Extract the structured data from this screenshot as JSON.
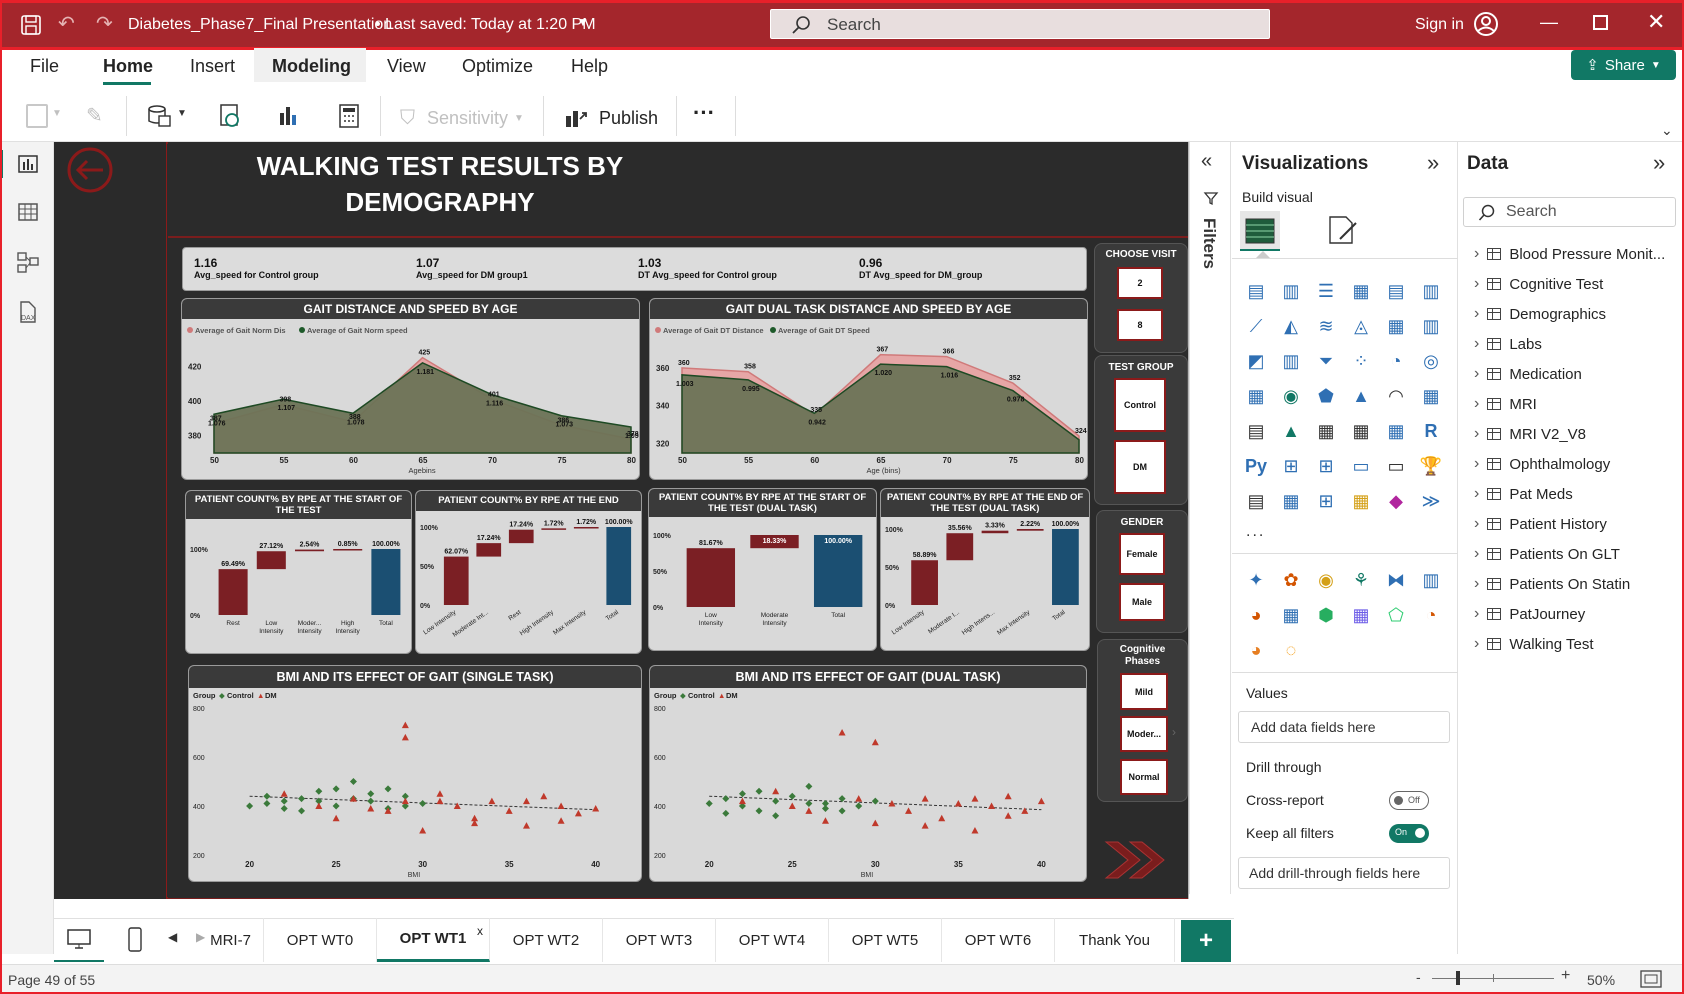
{
  "titlebar": {
    "doc_title": "Diabetes_Phase7_Final Presentation",
    "save_status": "• Last saved: Today at 1:20 PM",
    "search_placeholder": "Search",
    "sign_in": "Sign in"
  },
  "menu": {
    "file": "File",
    "home": "Home",
    "insert": "Insert",
    "modeling": "Modeling",
    "view": "View",
    "optimize": "Optimize",
    "help": "Help",
    "share": "Share"
  },
  "toolbar": {
    "sensitivity": "Sensitivity",
    "publish": "Publish",
    "more": "···"
  },
  "report": {
    "title_line1": "WALKING TEST RESULTS BY",
    "title_line2": "DEMOGRAPHY",
    "cards": [
      {
        "value": "1.16",
        "label": "Avg_speed for Control group"
      },
      {
        "value": "1.07",
        "label": "Avg_speed for DM group1"
      },
      {
        "value": "1.03",
        "label": "DT Avg_speed for Control group"
      },
      {
        "value": "0.96",
        "label": "DT Avg_speed for DM_group"
      }
    ],
    "gait_title": "GAIT DISTANCE AND SPEED BY AGE",
    "gait_legend_1": "Average of Gait Norm Dis",
    "gait_legend_2": "Average of Gait Norm speed",
    "gait_xlabel": "Agebins",
    "dual_title": "GAIT DUAL TASK DISTANCE AND SPEED BY AGE",
    "dual_legend_1": "Average of Gait DT Distance",
    "dual_legend_2": "Average of Gait DT Speed",
    "dual_xlabel": "Age (bins)",
    "rpe_start_title": "PATIENT COUNT% BY RPE AT THE START OF THE TEST",
    "rpe_end_title": "PATIENT COUNT% BY RPE AT THE END",
    "rpe_start_dt_title": "PATIENT COUNT% BY RPE AT THE START OF THE TEST (DUAL TASK)",
    "rpe_end_dt_title": "PATIENT COUNT% BY RPE AT THE END OF THE TEST (DUAL TASK)",
    "bmi_single_title": "BMI AND ITS EFFECT OF GAIT (SINGLE TASK)",
    "bmi_dual_title": "BMI AND ITS EFFECT OF GAIT (DUAL TASK)",
    "bmi_legend_group": "Group",
    "bmi_legend_control": "Control",
    "bmi_legend_dm": "DM",
    "bmi_xlabel": "BMI",
    "slicers": {
      "visit_label": "CHOOSE VISIT",
      "visit_options": [
        "2",
        "8"
      ],
      "group_label": "TEST GROUP",
      "group_options": [
        "Control",
        "DM"
      ],
      "gender_label": "GENDER",
      "gender_options": [
        "Female",
        "Male"
      ],
      "cog_label": "Cognitive Phases",
      "cog_options": [
        "Mild",
        "Moder...",
        "Normal"
      ]
    }
  },
  "chart_data": [
    {
      "type": "area",
      "title": "GAIT DISTANCE AND SPEED BY AGE",
      "xlabel": "Agebins",
      "x": [
        50,
        55,
        60,
        65,
        70,
        75,
        80
      ],
      "ylim": [
        370,
        430
      ],
      "yticks": [
        380,
        400,
        420
      ],
      "series": [
        {
          "name": "Average of Gait Norm Dis",
          "values": [
            387,
            398,
            388,
            425,
            401,
            386,
            378
          ],
          "color": "#d07a7a"
        },
        {
          "name": "Average of Gait Norm speed",
          "values": [
            1.076,
            1.107,
            1.078,
            1.181,
            1.116,
            1.073,
            1.05
          ],
          "color": "#1e5a2a"
        }
      ]
    },
    {
      "type": "area",
      "title": "GAIT DUAL TASK DISTANCE AND SPEED BY AGE",
      "xlabel": "Age (bins)",
      "x": [
        50,
        55,
        60,
        65,
        70,
        75,
        80
      ],
      "ylim": [
        315,
        370
      ],
      "yticks": [
        320,
        340,
        360
      ],
      "series": [
        {
          "name": "Average of Gait DT Distance",
          "values": [
            360,
            358,
            335,
            367,
            366,
            352,
            324
          ],
          "color": "#d07a7a"
        },
        {
          "name": "Average of Gait DT Speed",
          "values": [
            1.003,
            0.995,
            0.942,
            1.02,
            1.016,
            0.978,
            0.9
          ],
          "color": "#1e5a2a"
        }
      ]
    },
    {
      "type": "bar",
      "title": "PATIENT COUNT% BY RPE AT THE START OF THE TEST",
      "categories": [
        "Rest",
        "Low Intensity",
        "Moder... Intensity",
        "High Intensity",
        "Total"
      ],
      "labels": [
        "69.49%",
        "27.12%",
        "2.54%",
        "0.85%",
        "100.00%"
      ],
      "values": [
        69.49,
        27.12,
        2.54,
        0.85,
        100.0
      ],
      "yticks": [
        "0%",
        "100%"
      ]
    },
    {
      "type": "bar",
      "title": "PATIENT COUNT% BY RPE AT THE END",
      "categories": [
        "Low Intensity",
        "Moderate Int...",
        "Rest",
        "High Intensity",
        "Max Intensity",
        "Total"
      ],
      "labels": [
        "62.07%",
        "17.24%",
        "17.24%",
        "1.72%",
        "1.72%",
        "100.00%"
      ],
      "values": [
        62.07,
        17.24,
        17.24,
        1.72,
        1.72,
        100.0
      ],
      "yticks": [
        "0%",
        "50%",
        "100%"
      ]
    },
    {
      "type": "bar",
      "title": "PATIENT COUNT% BY RPE AT THE START OF THE TEST (DUAL TASK)",
      "categories": [
        "Low Intensity",
        "Moderate Intensity",
        "Total"
      ],
      "labels": [
        "81.67%",
        "18.33%",
        "100.00%"
      ],
      "values": [
        81.67,
        18.33,
        100.0
      ],
      "yticks": [
        "0%",
        "50%",
        "100%"
      ]
    },
    {
      "type": "bar",
      "title": "PATIENT COUNT% BY RPE AT THE END OF THE TEST (DUAL TASK)",
      "categories": [
        "Low Intensity",
        "Moderate I...",
        "High Intens...",
        "Max Intensity",
        "Total"
      ],
      "labels": [
        "58.89%",
        "35.56%",
        "3.33%",
        "2.22%",
        "100.00%"
      ],
      "values": [
        58.89,
        35.56,
        3.33,
        2.22,
        100.0
      ],
      "yticks": [
        "0%",
        "50%",
        "100%"
      ]
    },
    {
      "type": "scatter",
      "title": "BMI AND ITS EFFECT OF GAIT (SINGLE TASK)",
      "xlabel": "BMI",
      "xlim": [
        18,
        41
      ],
      "ylim": [
        200,
        800
      ],
      "xticks": [
        20,
        25,
        30,
        35,
        40
      ],
      "yticks": [
        200,
        400,
        600,
        800
      ],
      "series": [
        {
          "name": "Control",
          "color": "#3b7a3b",
          "points": [
            [
              20,
              400
            ],
            [
              21,
              440
            ],
            [
              22,
              420
            ],
            [
              23,
              380
            ],
            [
              24,
              460
            ],
            [
              25,
              470
            ],
            [
              25,
              400
            ],
            [
              26,
              430
            ],
            [
              27,
              450
            ],
            [
              28,
              390
            ],
            [
              29,
              440
            ],
            [
              30,
              410
            ],
            [
              22,
              390
            ],
            [
              24,
              420
            ],
            [
              26,
              500
            ],
            [
              28,
              470
            ],
            [
              23,
              430
            ],
            [
              21,
              410
            ],
            [
              27,
              420
            ],
            [
              29,
              400
            ]
          ]
        },
        {
          "name": "DM",
          "color": "#c0392b",
          "points": [
            [
              22,
              450
            ],
            [
              24,
              400
            ],
            [
              26,
              430
            ],
            [
              28,
              380
            ],
            [
              29,
              420
            ],
            [
              30,
              300
            ],
            [
              31,
              450
            ],
            [
              32,
              400
            ],
            [
              33,
              350
            ],
            [
              34,
              420
            ],
            [
              35,
              380
            ],
            [
              36,
              320
            ],
            [
              37,
              440
            ],
            [
              38,
              400
            ],
            [
              39,
              370
            ],
            [
              40,
              390
            ],
            [
              29,
              730
            ],
            [
              29,
              680
            ],
            [
              31,
              420
            ],
            [
              33,
              330
            ],
            [
              25,
              350
            ],
            [
              27,
              390
            ],
            [
              36,
              420
            ],
            [
              38,
              340
            ]
          ]
        }
      ]
    },
    {
      "type": "scatter",
      "title": "BMI AND ITS EFFECT OF GAIT (DUAL TASK)",
      "xlabel": "BMI",
      "xlim": [
        18,
        41
      ],
      "ylim": [
        200,
        800
      ],
      "xticks": [
        20,
        25,
        30,
        35,
        40
      ],
      "yticks": [
        200,
        400,
        600,
        800
      ],
      "series": [
        {
          "name": "Control",
          "color": "#3b7a3b",
          "points": [
            [
              20,
              410
            ],
            [
              21,
              430
            ],
            [
              22,
              400
            ],
            [
              23,
              380
            ],
            [
              24,
              420
            ],
            [
              25,
              440
            ],
            [
              26,
              410
            ],
            [
              27,
              390
            ],
            [
              28,
              430
            ],
            [
              29,
              400
            ],
            [
              30,
              420
            ],
            [
              22,
              450
            ],
            [
              24,
              360
            ],
            [
              26,
              480
            ],
            [
              28,
              380
            ],
            [
              21,
              370
            ],
            [
              23,
              460
            ],
            [
              27,
              410
            ]
          ]
        },
        {
          "name": "DM",
          "color": "#c0392b",
          "points": [
            [
              22,
              420
            ],
            [
              24,
              460
            ],
            [
              26,
              380
            ],
            [
              28,
              700
            ],
            [
              29,
              430
            ],
            [
              30,
              330
            ],
            [
              31,
              410
            ],
            [
              32,
              380
            ],
            [
              33,
              430
            ],
            [
              34,
              350
            ],
            [
              35,
              410
            ],
            [
              36,
              300
            ],
            [
              37,
              400
            ],
            [
              38,
              440
            ],
            [
              39,
              380
            ],
            [
              40,
              420
            ],
            [
              30,
              660
            ],
            [
              27,
              340
            ],
            [
              33,
              320
            ],
            [
              36,
              430
            ],
            [
              38,
              360
            ],
            [
              25,
              400
            ]
          ]
        }
      ]
    }
  ],
  "filters_label": "Filters",
  "visualizations": {
    "title": "Visualizations",
    "build_visual": "Build visual",
    "values_label": "Values",
    "values_placeholder": "Add data fields here",
    "drill_through": "Drill through",
    "cross_report": "Cross-report",
    "cross_report_state": "Off",
    "keep_filters": "Keep all filters",
    "keep_filters_state": "On",
    "drill_placeholder": "Add drill-through fields here",
    "more": "..."
  },
  "data_pane": {
    "title": "Data",
    "search_placeholder": "Search",
    "tables": [
      "Blood Pressure Monit...",
      "Cognitive Test",
      "Demographics",
      "Labs",
      "Medication",
      "MRI",
      "MRI V2_V8",
      "Ophthalmology",
      "Pat Meds",
      "Patient History",
      "Patients On GLT",
      "Patients On Statin",
      "PatJourney",
      "Walking Test"
    ]
  },
  "tabs": {
    "pages": [
      "MRI-7",
      "OPT WT0",
      "OPT WT1",
      "OPT WT2",
      "OPT WT3",
      "OPT WT4",
      "OPT WT5",
      "OPT WT6",
      "Thank You"
    ],
    "active": "OPT WT1",
    "close": "x",
    "add": "+"
  },
  "status": {
    "page": "Page 49 of 55",
    "zoom": "50%"
  }
}
